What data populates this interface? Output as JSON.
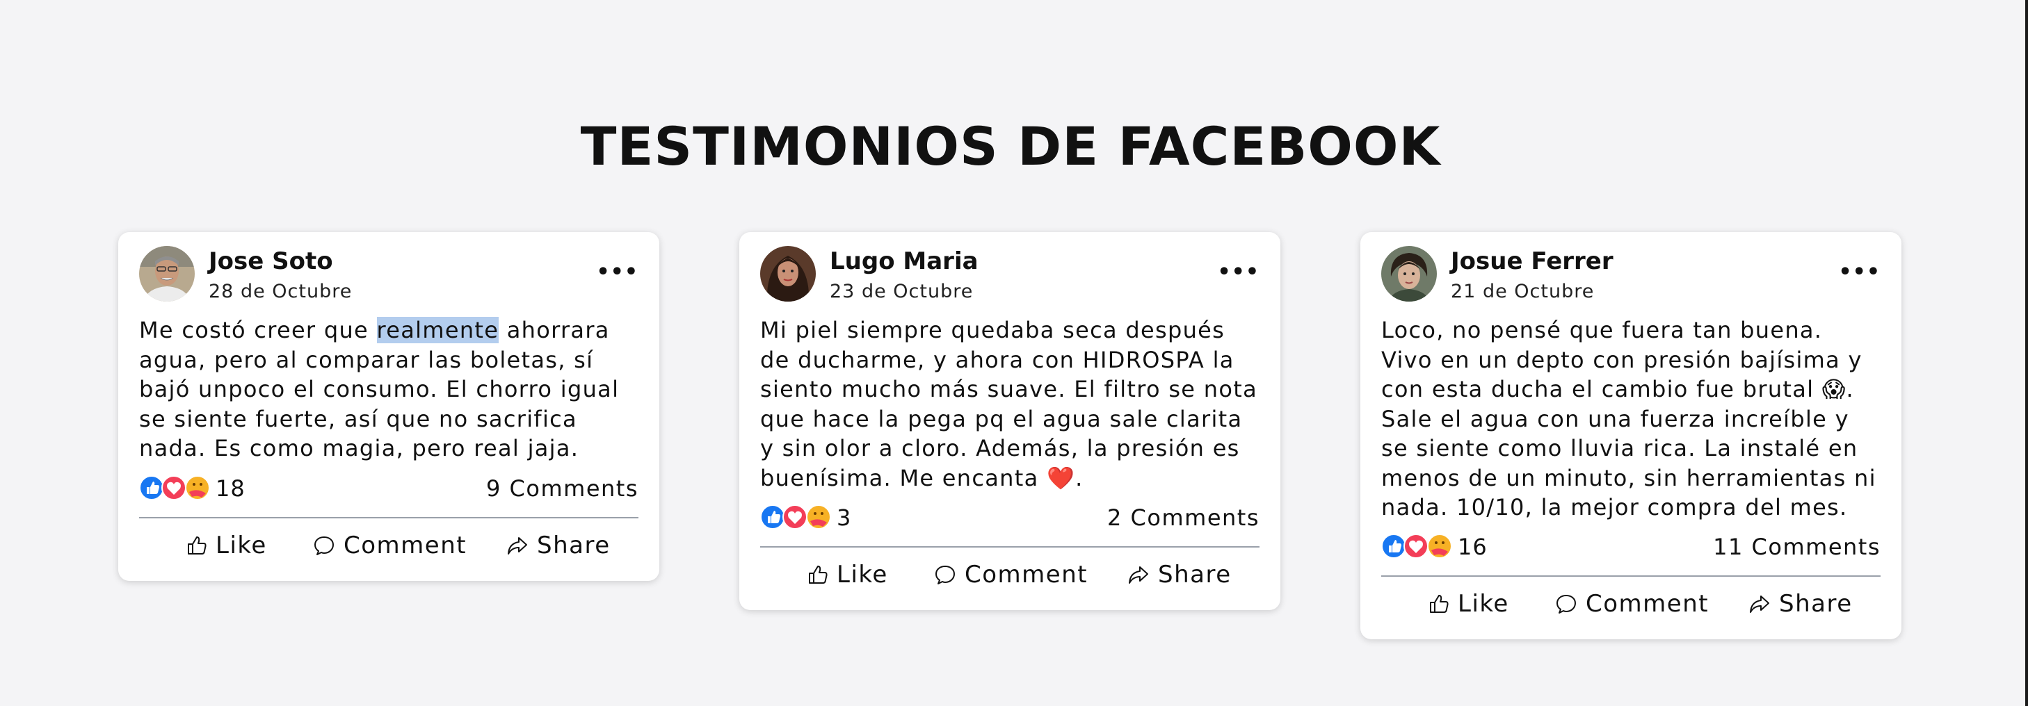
{
  "section": {
    "title": "TESTIMONIOS DE FACEBOOK"
  },
  "colors": {
    "like_blue": "#1877f2",
    "love_red": "#f33e58",
    "care_yellow": "#f7b125",
    "highlight": "#b3cdee"
  },
  "posts": [
    {
      "author": "Jose Soto",
      "date": "28 de Octubre",
      "more_icon": "ellipsis-icon",
      "text_before": "Me costó creer que ",
      "text_highlight": "realmente",
      "text_after": " ahorrara agua, pero al comparar las boletas, sí bajó unpoco el consumo. El chorro igual se siente fuerte, así que no sacrifica nada. Es como magia, pero real jaja.",
      "reactions": "18",
      "comments": "9 Comments",
      "actions": {
        "like": "Like",
        "comment": "Comment",
        "share": "Share"
      }
    },
    {
      "author": "Lugo Maria",
      "date": "23 de Octubre",
      "more_icon": "ellipsis-icon",
      "text": "Mi piel siempre quedaba seca después de ducharme, y ahora con HIDROSPA la siento mucho más suave. El filtro se nota que hace la pega pq el agua sale clarita y sin olor a cloro. Además, la presión es buenísima. Me encanta ❤️.",
      "reactions": "3",
      "comments": "2 Comments",
      "actions": {
        "like": "Like",
        "comment": "Comment",
        "share": "Share"
      }
    },
    {
      "author": "Josue Ferrer",
      "date": "21 de Octubre",
      "more_icon": "ellipsis-icon",
      "text": "Loco, no pensé que fuera tan buena. Vivo en un depto con presión bajísima y con esta ducha el cambio fue brutal 😱. Sale el agua con una fuerza increíble y se siente como lluvia rica. La instalé en menos de un minuto, sin herramientas ni nada. 10/10, la mejor compra del mes.",
      "reactions": "16",
      "comments": "11 Comments",
      "actions": {
        "like": "Like",
        "comment": "Comment",
        "share": "Share"
      }
    }
  ]
}
